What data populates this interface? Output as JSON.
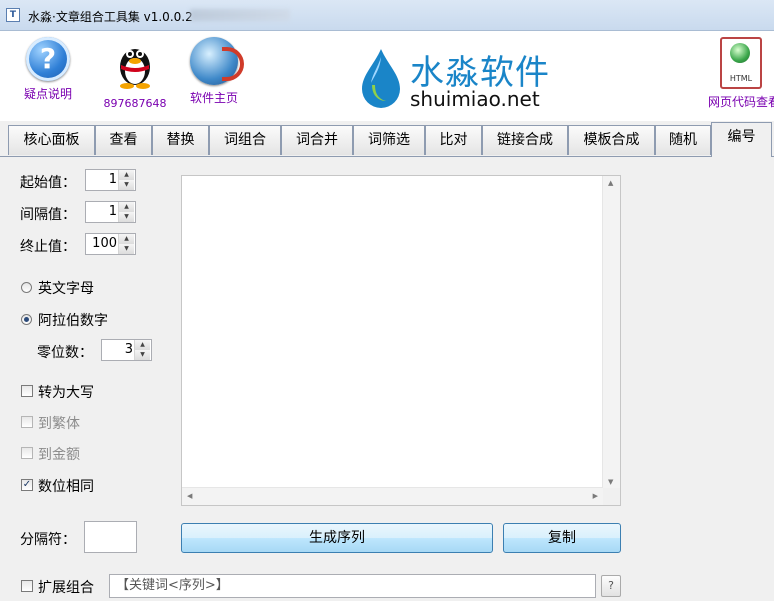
{
  "window": {
    "title": "水淼·文章组合工具集 v1.0.0.2"
  },
  "header": {
    "help_label": "疑点说明",
    "qq_label": "897687648",
    "home_label": "软件主页",
    "html_label": "网页代码查看",
    "html_icon_text": "HTML",
    "logo_cn": "水淼软件",
    "logo_en": "shuimiao.net"
  },
  "tabs": [
    {
      "label": "核心面板"
    },
    {
      "label": "查看"
    },
    {
      "label": "替换"
    },
    {
      "label": "词组合"
    },
    {
      "label": "词合并"
    },
    {
      "label": "词筛选"
    },
    {
      "label": "比对"
    },
    {
      "label": "链接合成"
    },
    {
      "label": "模板合成"
    },
    {
      "label": "随机"
    },
    {
      "label": "编号"
    }
  ],
  "active_tab": "编号",
  "form": {
    "start_label": "起始值：",
    "start_value": "1",
    "interval_label": "间隔值：",
    "interval_value": "1",
    "end_label": "终止值：",
    "end_value": "100",
    "opt_letters": "英文字母",
    "opt_digits": "阿拉伯数字",
    "zero_label": "零位数：",
    "zero_value": "3",
    "to_upper": "转为大写",
    "to_traditional": "到繁体",
    "to_amount": "到金额",
    "same_digits": "数位相同",
    "separator_label": "分隔符：",
    "separator_value": "",
    "generate_button": "生成序列",
    "copy_button": "复制",
    "extend_label": "扩展组合",
    "keyword_value": "【关键词<序列>】",
    "help_button": "?"
  },
  "state": {
    "selected_radio": "阿拉伯数字",
    "to_upper": false,
    "to_traditional": false,
    "to_amount": false,
    "same_digits": true,
    "extend": false
  },
  "colors": {
    "link_purple": "#7a00b0",
    "logo_blue": "#1a85c8",
    "button_border": "#3c7fb1"
  }
}
